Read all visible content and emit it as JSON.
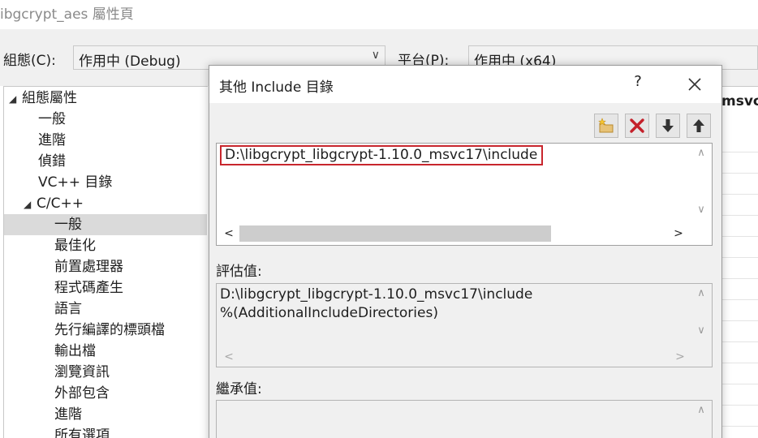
{
  "window": {
    "title": "ibgcrypt_aes 屬性頁"
  },
  "toolbar": {
    "config_label": "組態(C):",
    "config_value": "作用中 (Debug)",
    "platform_label": "平台(P):",
    "platform_value": "作用中 (x64)"
  },
  "tree": {
    "items": [
      {
        "label": "組態屬性",
        "expanded": true
      },
      {
        "label": "一般"
      },
      {
        "label": "進階"
      },
      {
        "label": "偵錯"
      },
      {
        "label": "VC++ 目錄"
      },
      {
        "label": "C/C++",
        "expanded": true
      },
      {
        "label": "一般",
        "selected": true
      },
      {
        "label": "最佳化"
      },
      {
        "label": "前置處理器"
      },
      {
        "label": "程式碼產生"
      },
      {
        "label": "語言"
      },
      {
        "label": "先行編譯的標頭檔"
      },
      {
        "label": "輸出檔"
      },
      {
        "label": "瀏覽資訊"
      },
      {
        "label": "外部包含"
      },
      {
        "label": "進階"
      },
      {
        "label": "所有選項"
      }
    ]
  },
  "background_grid": {
    "cut_text": "msvc"
  },
  "dialog": {
    "title": "其他 Include 目錄",
    "help": "?",
    "buttons": [
      "new-line-icon",
      "delete-icon",
      "move-down-icon",
      "move-up-icon"
    ],
    "entries": [
      "D:\\libgcrypt_libgcrypt-1.10.0_msvc17\\include"
    ],
    "evaluated_label": "評估值:",
    "evaluated_lines": [
      "D:\\libgcrypt_libgcrypt-1.10.0_msvc17\\include",
      "%(AdditionalIncludeDirectories)"
    ],
    "inherited_label": "繼承值:"
  },
  "colors": {
    "highlight_border": "#c8262d",
    "selected_tree_bg": "#dadada"
  }
}
